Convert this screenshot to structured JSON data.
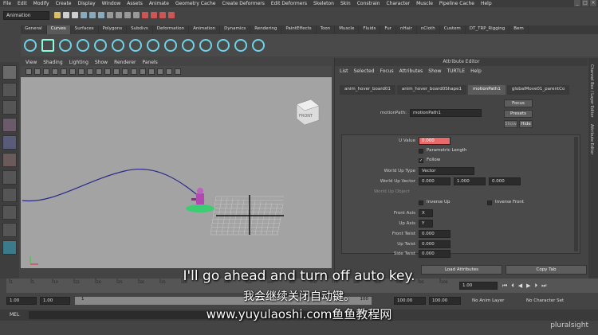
{
  "menubar": [
    "File",
    "Edit",
    "Modify",
    "Create",
    "Display",
    "Window",
    "Assets",
    "Animate",
    "Geometry Cache",
    "Create Deformers",
    "Edit Deformers",
    "Skeleton",
    "Skin",
    "Constrain",
    "Character",
    "Muscle",
    "Pipeline Cache",
    "Help"
  ],
  "mode": "Animation",
  "shelf_tabs": [
    "General",
    "Curves",
    "Surfaces",
    "Polygons",
    "Subdivs",
    "Deformation",
    "Animation",
    "Dynamics",
    "Rendering",
    "PaintEffects",
    "Toon",
    "Muscle",
    "Fluids",
    "Fur",
    "nHair",
    "nCloth",
    "Custom",
    "DT_TRP_Rigging",
    "Bem"
  ],
  "shelf_active": "Curves",
  "viewport": {
    "menu": [
      "View",
      "Shading",
      "Lighting",
      "Show",
      "Renderer",
      "Panels"
    ],
    "view_cube": "FRONT"
  },
  "attribute_editor": {
    "title": "Attribute Editor",
    "menu": [
      "List",
      "Selected",
      "Focus",
      "Attributes",
      "Show",
      "TURTLE",
      "Help"
    ],
    "tabs": [
      "anim_hover_board01",
      "anim_hover_board0Shape1",
      "motionPath1",
      "globalMove01_parentCo"
    ],
    "active_tab": "motionPath1",
    "node_label": "motionPath:",
    "node_value": "motionPath1",
    "buttons": {
      "focus": "Focus",
      "presets": "Presets",
      "show": "Show",
      "hide": "Hide"
    },
    "u_value_label": "U Value",
    "u_value": "0.000",
    "parametric_length": "Parametric Length",
    "follow": "Follow",
    "world_up_type_label": "World Up Type",
    "world_up_type": "Vector",
    "world_up_vector_label": "World Up Vector",
    "world_up_vector": [
      "0.000",
      "1.000",
      "0.000"
    ],
    "world_up_object": "World Up Object",
    "inverse_up": "Inverse Up",
    "inverse_front": "Inverse Front",
    "front_axis_label": "Front Axis",
    "front_axis": "X",
    "up_axis_label": "Up Axis",
    "up_axis": "Y",
    "front_twist_label": "Front Twist",
    "front_twist": "0.000",
    "up_twist_label": "Up Twist",
    "up_twist": "0.000",
    "side_twist_label": "Side Twist",
    "side_twist": "0.000",
    "load_attributes": "Load Attributes",
    "copy_tab": "Copy Tab"
  },
  "sidebar_tabs": [
    "Channel Box / Layer Editor",
    "Attribute Editor"
  ],
  "timeline": {
    "ticks": [
      "1",
      "5",
      "10",
      "15",
      "20",
      "25",
      "30",
      "35",
      "40",
      "45",
      "50",
      "55",
      "60",
      "65",
      "70",
      "75",
      "80",
      "85",
      "90",
      "95",
      "100"
    ],
    "current_frame": "1.00"
  },
  "range": {
    "start": "1.00",
    "start2": "1.00",
    "marker": "1",
    "end1": "100",
    "end2": "100.00",
    "end3": "100.00",
    "anim_layer": "No Anim Layer",
    "char_set": "No Character Set"
  },
  "mel_label": "MEL",
  "subtitles": {
    "english": "I'll go ahead and turn off auto key.",
    "chinese": "我会继续关闭自动键。",
    "watermark": "www.yuyulaoshi.com鱼鱼教程网"
  },
  "logo": "pluralsight",
  "colors": {
    "curve": "#2a2a8a",
    "grid": "#c8c8c8",
    "accent": "#e86a6a",
    "shelf": "#6fd3e7"
  }
}
